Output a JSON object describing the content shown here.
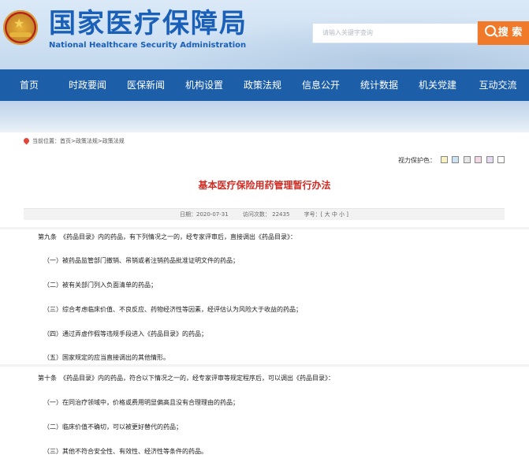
{
  "header": {
    "site_title": "国家医疗保障局",
    "site_subtitle": "National Healthcare Security Administration",
    "search_placeholder": "请输入关键字查询",
    "search_button": "搜 索"
  },
  "nav": {
    "items": [
      {
        "label": "首页"
      },
      {
        "label": "时政要闻"
      },
      {
        "label": "医保新闻"
      },
      {
        "label": "机构设置"
      },
      {
        "label": "政策法规"
      },
      {
        "label": "信息公开"
      },
      {
        "label": "统计数据"
      },
      {
        "label": "机关党建"
      },
      {
        "label": "互动交流"
      }
    ]
  },
  "breadcrumb": "当前位置：首页>政策法规>政策法规",
  "vision": {
    "label": "视力保护色：",
    "colors": [
      "#f7f1c0",
      "#c9e3f5",
      "#e6e6e6",
      "#f4d6e4",
      "#e6d9f2",
      "#ffffff"
    ]
  },
  "article": {
    "title": "基本医疗保险用药管理暂行办法",
    "date": "日期：2020-07-31",
    "visits": "访问次数： 22435",
    "fontsize": "字号：[ 大 中 小 ]"
  },
  "paragraphs": [
    "第九条　《药品目录》内的药品，有下列情况之一的，经专家评审后，直接调出《药品目录》：",
    "（一）被药品监管部门撤销、吊销或者注销药品批准证明文件的药品；",
    "（二）被有关部门列入负面清单的药品；",
    "（三）综合考虑临床价值、不良反应、药物经济性等因素，经评估认为风险大于收益的药品；",
    "（四）通过弄虚作假等违规手段进入《药品目录》的药品；",
    "（五）国家规定的应当直接调出的其他情形。",
    "第十条　《药品目录》内的药品，符合以下情况之一的，经专家评审等规定程序后，可以调出《药品目录》：",
    "（一）在同治疗领域中，价格或费用明显偏高且没有合理理由的药品；",
    "（二）临床价值不确切，可以被更好替代的药品；",
    "（三）其他不符合安全性、有效性、经济性等条件的药品。"
  ]
}
